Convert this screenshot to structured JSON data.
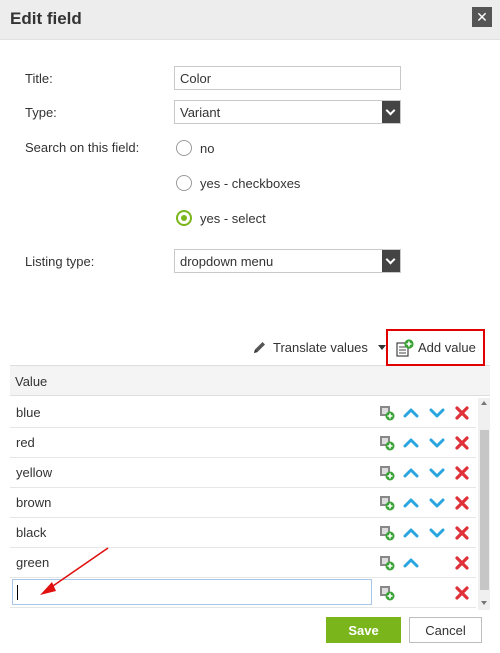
{
  "dialog": {
    "title": "Edit field",
    "close_icon": "close-icon"
  },
  "form": {
    "title_label": "Title:",
    "title_value": "Color",
    "type_label": "Type:",
    "type_value": "Variant",
    "search_label": "Search on this field:",
    "search_options": [
      {
        "label": "no",
        "selected": false
      },
      {
        "label": "yes - checkboxes",
        "selected": false
      },
      {
        "label": "yes - select",
        "selected": true
      }
    ],
    "listing_label": "Listing type:",
    "listing_value": "dropdown menu"
  },
  "values_panel": {
    "translate_label": "Translate values",
    "add_label": "Add value",
    "column_header": "Value",
    "rows": [
      {
        "label": "blue",
        "up": true,
        "down": true
      },
      {
        "label": "red",
        "up": true,
        "down": true
      },
      {
        "label": "yellow",
        "up": true,
        "down": true
      },
      {
        "label": "brown",
        "up": true,
        "down": true
      },
      {
        "label": "black",
        "up": true,
        "down": true
      },
      {
        "label": "green",
        "up": true,
        "down": false
      }
    ],
    "new_row_value": ""
  },
  "footer": {
    "save_label": "Save",
    "cancel_label": "Cancel"
  },
  "colors": {
    "accent_green": "#7bb51c",
    "move_blue": "#2aa5e0",
    "delete_red": "#e0303a",
    "highlight_red": "#e00000"
  }
}
